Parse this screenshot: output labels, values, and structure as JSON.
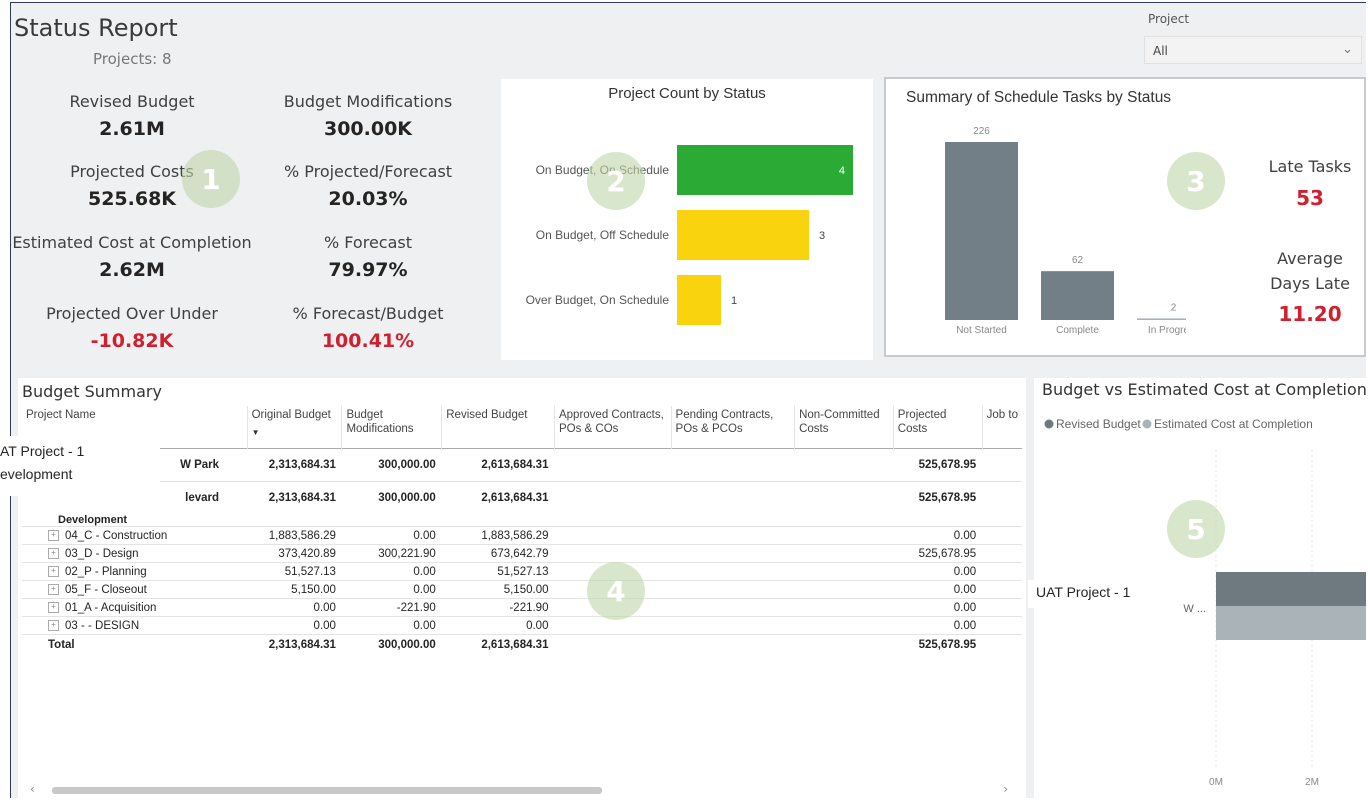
{
  "header": {
    "title": "Status Report",
    "subtitle": "Projects: 8"
  },
  "filter": {
    "label": "Project",
    "value": "All"
  },
  "kpis": {
    "revised_budget": {
      "label": "Revised Budget",
      "value": "2.61M"
    },
    "budget_mods": {
      "label": "Budget Modifications",
      "value": "300.00K"
    },
    "projected_costs": {
      "label": "Projected Costs",
      "value": "525.68K"
    },
    "pct_proj_forecast": {
      "label": "% Projected/Forecast",
      "value": "20.03%"
    },
    "eac": {
      "label": "Estimated Cost at Completion",
      "value": "2.62M"
    },
    "pct_forecast": {
      "label": "% Forecast",
      "value": "79.97%"
    },
    "over_under": {
      "label": "Projected Over Under",
      "value": "-10.82K"
    },
    "pct_forecast_budget": {
      "label": "% Forecast/Budget",
      "value": "100.41%"
    }
  },
  "badges": [
    "1",
    "2",
    "3",
    "4",
    "5"
  ],
  "colors": {
    "green": "#2bab36",
    "yellow": "#f9d30e",
    "gray_bar": "#737f87",
    "light_gray": "#aab3b8",
    "red": "#d0202f"
  },
  "schedule": {
    "title": "Summary of Schedule Tasks by Status",
    "late_label": "Late Tasks",
    "late_value": "53",
    "avg_label_1": "Average",
    "avg_label_2": "Days Late",
    "avg_value": "11.20"
  },
  "budget_table": {
    "title": "Budget Summary",
    "headers": [
      "Project Name",
      "Original Budget",
      "Budget Modifications",
      "Revised Budget",
      "Approved Contracts, POs & COs",
      "Pending Contracts, POs & PCOs",
      "Non-Committed Costs",
      "Projected Costs",
      "Job to"
    ],
    "tooltip_line1": "AT  Project - 1",
    "tooltip_line2": "evelopment",
    "rows": [
      {
        "name": "W Park",
        "orig": "2,313,684.31",
        "mods": "300,000.00",
        "rev": "2,613,684.31",
        "proj": "525,678.95"
      },
      {
        "name": "levard",
        "orig": "2,313,684.31",
        "mods": "300,000.00",
        "rev": "2,613,684.31",
        "proj": "525,678.95"
      },
      {
        "name": "Development",
        "orig": "",
        "mods": "",
        "rev": "",
        "proj": ""
      },
      {
        "name": "04_C - Construction",
        "orig": "1,883,586.29",
        "mods": "0.00",
        "rev": "1,883,586.29",
        "proj": "0.00"
      },
      {
        "name": "03_D - Design",
        "orig": "373,420.89",
        "mods": "300,221.90",
        "rev": "673,642.79",
        "proj": "525,678.95"
      },
      {
        "name": "02_P - Planning",
        "orig": "51,527.13",
        "mods": "0.00",
        "rev": "51,527.13",
        "proj": "0.00"
      },
      {
        "name": "05_F - Closeout",
        "orig": "5,150.00",
        "mods": "0.00",
        "rev": "5,150.00",
        "proj": "0.00"
      },
      {
        "name": "01_A - Acquisition",
        "orig": "0.00",
        "mods": "-221.90",
        "rev": "-221.90",
        "proj": "0.00"
      },
      {
        "name": "03 - - DESIGN",
        "orig": "0.00",
        "mods": "0.00",
        "rev": "0.00",
        "proj": "0.00"
      }
    ],
    "total": {
      "name": "Total",
      "orig": "2,313,684.31",
      "mods": "300,000.00",
      "rev": "2,613,684.31",
      "proj": "525,678.95"
    }
  },
  "bve": {
    "title": "Budget vs Estimated Cost at Completion",
    "tooltip": "UAT  Project - 1"
  },
  "chart_data": [
    {
      "type": "bar",
      "orientation": "horizontal",
      "title": "Project Count by Status",
      "categories": [
        "On Budget, On Schedule",
        "On Budget, Off Schedule",
        "Over Budget, On Schedule"
      ],
      "values": [
        4,
        3,
        1
      ],
      "colors": [
        "#2bab36",
        "#f9d30e",
        "#f9d30e"
      ]
    },
    {
      "type": "bar",
      "orientation": "vertical",
      "title": "Summary of Schedule Tasks by Status",
      "categories": [
        "Not Started",
        "Complete",
        "In Progress"
      ],
      "values": [
        226,
        62,
        2
      ]
    },
    {
      "type": "bar",
      "orientation": "horizontal",
      "title": "Budget vs Estimated Cost at Completion",
      "categories": [
        "W ..."
      ],
      "series": [
        {
          "name": "Revised Budget",
          "values": [
            2.61
          ]
        },
        {
          "name": "Estimated Cost at Completion",
          "values": [
            2.62
          ]
        }
      ],
      "xticks": [
        "0M",
        "2M"
      ],
      "xlim": [
        0,
        2.5
      ],
      "legend": "top-left"
    }
  ]
}
